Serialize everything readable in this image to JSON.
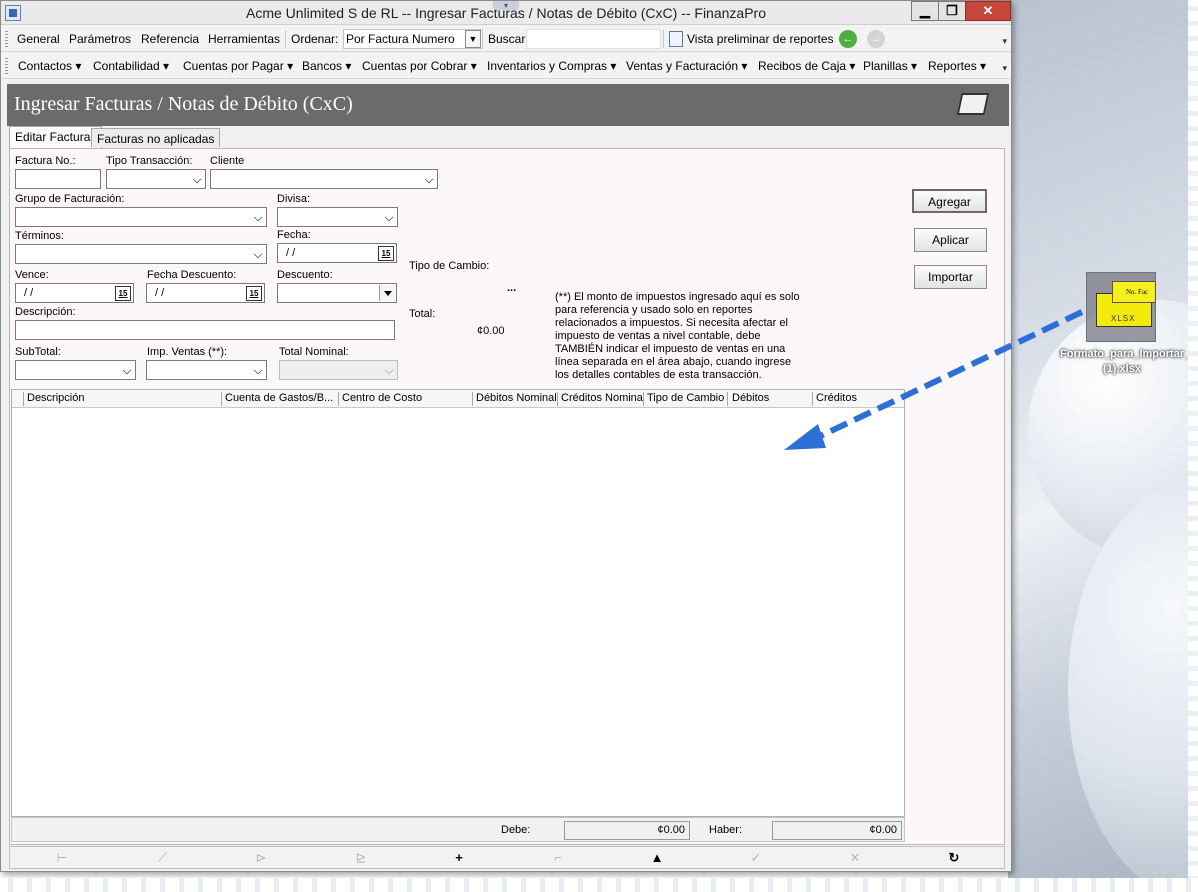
{
  "window": {
    "title": "Acme Unlimited S de RL -- Ingresar Facturas / Notas de Débito (CxC) -- FinanzaPro",
    "min": "▁",
    "max": "❐",
    "close": "✕"
  },
  "toolbar1": {
    "items": [
      "General",
      "Parámetros",
      "Referencia",
      "Herramientas"
    ],
    "order_label": "Ordenar:",
    "order_value": "Por Factura Numero",
    "search_label": "Buscar:",
    "preview_label": "Vista preliminar de reportes",
    "back_icon": "←",
    "forward_icon": "→",
    "overflow": "▾"
  },
  "toolbar2": {
    "items": [
      "Contactos ▾",
      "Contabilidad ▾",
      "Cuentas por Pagar ▾",
      "Bancos ▾",
      "Cuentas por Cobrar ▾",
      "Inventarios y Compras ▾",
      "Ventas y Facturación ▾",
      "Recibos de Caja ▾",
      "Planillas ▾",
      "Reportes ▾"
    ],
    "overflow": "▾"
  },
  "header": {
    "title": "Ingresar Facturas / Notas de Débito (CxC)"
  },
  "tabs": [
    {
      "label": "Editar Facturas"
    },
    {
      "label": "Facturas no aplicadas"
    }
  ],
  "form": {
    "factura_no": "Factura No.:",
    "tipo_transaccion": "Tipo Transacción:",
    "cliente": "Cliente",
    "grupo_facturacion": "Grupo de Facturación:",
    "divisa": "Divisa:",
    "terminos": "Términos:",
    "fecha": "Fecha:",
    "fecha_value": "/  /",
    "vence": "Vence:",
    "vence_value": "/  /",
    "fecha_descuento": "Fecha Descuento:",
    "fecha_descuento_value": "/  /",
    "descuento": "Descuento:",
    "descripcion": "Descripción:",
    "subtotal": "SubTotal:",
    "imp_ventas": "Imp. Ventas (**):",
    "total_nominal": "Total Nominal:",
    "tipo_cambio": "Tipo de Cambio:",
    "tipo_cambio_value": "...",
    "total": "Total:",
    "total_value": "¢0.00",
    "calendar": "15",
    "note": "(**) El monto de impuestos ingresado aquí es solo para referencia y usado solo en reportes relacionados a impuestos. Si necesita afectar el impuesto de ventas a nivel contable, debe TAMBIÉN indicar el impuesto de ventas en una línea separada en el área abajo, cuando ingrese los detalles contables de esta transacción."
  },
  "buttons": {
    "agregar": "Agregar",
    "aplicar": "Aplicar",
    "importar": "Importar"
  },
  "grid": {
    "columns": [
      "Descripción",
      "Cuenta de Gastos/B...",
      "Centro de Costo",
      "Débitos Nominal",
      "Créditos Nominal",
      "Tipo de Cambio",
      "Débitos",
      "Créditos"
    ]
  },
  "totals": {
    "debe_label": "Debe:",
    "debe_value": "¢0.00",
    "haber_label": "Haber:",
    "haber_value": "¢0.00"
  },
  "navbar": {
    "icons": [
      "⊢",
      "⟋",
      "⊳",
      "⊵",
      "+",
      "⌐",
      "▲",
      "✓",
      "✕",
      "↻"
    ]
  },
  "desktop_file": {
    "name": "Formato_para_Importar_C...r (1).xlsx",
    "sheet_text": "No. Fac",
    "ext_text": "XLSX"
  },
  "colors": {
    "header_bg": "#6b6b6b",
    "arrow": "#2d6fd6",
    "file_yellow": "#f3ea0b"
  }
}
